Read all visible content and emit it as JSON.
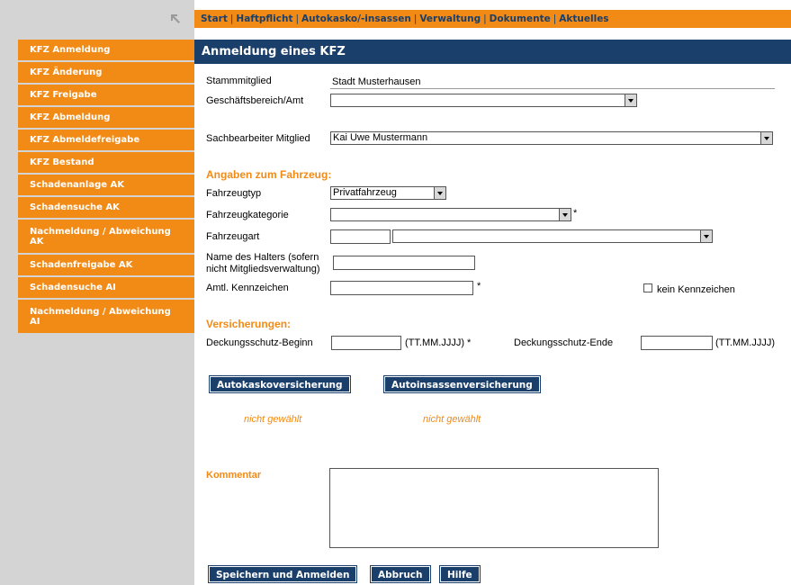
{
  "topnav": {
    "items": [
      "Start",
      "Haftpflicht",
      "Autokasko/-insassen",
      "Verwaltung",
      "Dokumente",
      "Aktuelles"
    ],
    "separator": "|"
  },
  "sidebar": {
    "items": [
      {
        "label": "KFZ Anmeldung"
      },
      {
        "label": "KFZ Änderung"
      },
      {
        "label": "KFZ Freigabe"
      },
      {
        "label": "KFZ Abmeldung"
      },
      {
        "label": "KFZ Abmeldefreigabe"
      },
      {
        "label": "KFZ Bestand"
      },
      {
        "label": "Schadenanlage AK"
      },
      {
        "label": "Schadensuche AK"
      },
      {
        "label": "Nachmeldung / Abweichung AK"
      },
      {
        "label": "Schadenfreigabe AK"
      },
      {
        "label": "Schadensuche AI"
      },
      {
        "label": "Nachmeldung / Abweichung AI"
      }
    ]
  },
  "page": {
    "title": "Anmeldung eines KFZ"
  },
  "form": {
    "stammmitglied_label": "Stammmitglied",
    "stammmitglied_value": "Stadt Musterhausen",
    "geschaeftsbereich_label": "Geschäftsbereich/Amt",
    "geschaeftsbereich_value": "",
    "sachbearbeiter_label": "Sachbearbeiter Mitglied",
    "sachbearbeiter_value": "Kai Uwe Mustermann",
    "section_fahrzeug": "Angaben zum Fahrzeug:",
    "fahrzeugtyp_label": "Fahrzeugtyp",
    "fahrzeugtyp_value": "Privatfahrzeug",
    "fahrzeugkategorie_label": "Fahrzeugkategorie",
    "fahrzeugkategorie_value": "",
    "required_mark": "*",
    "fahrzeugart_label": "Fahrzeugart",
    "halter_label_line1": "Name des Halters (sofern",
    "halter_label_line2": "nicht Mitgliedsverwaltung)",
    "kennzeichen_label": "Amtl. Kennzeichen",
    "kein_kennzeichen_label": "kein Kennzeichen",
    "section_versicherungen": "Versicherungen:",
    "beginn_label": "Deckungsschutz-Beginn",
    "beginn_hint": "(TT.MM.JJJJ) *",
    "ende_label": "Deckungsschutz-Ende",
    "ende_hint": "(TT.MM.JJJJ)",
    "kommentar_label": "Kommentar"
  },
  "insurance": {
    "autokasko_button": "Autokaskoversicherung",
    "autoinsassen_button": "Autoinsassenversicherung",
    "autokasko_status": "nicht gewählt",
    "autoinsassen_status": "nicht gewählt"
  },
  "actions": {
    "save_label": "Speichern und Anmelden",
    "cancel_label": "Abbruch",
    "help_label": "Hilfe"
  },
  "colors": {
    "accent_orange": "#f28a16",
    "navy": "#1a3f6a",
    "sidebar_bg": "#d4d4d4"
  },
  "icons": {
    "back_arrow": "arrow-up-left-icon",
    "dropdown": "chevron-down-icon"
  }
}
